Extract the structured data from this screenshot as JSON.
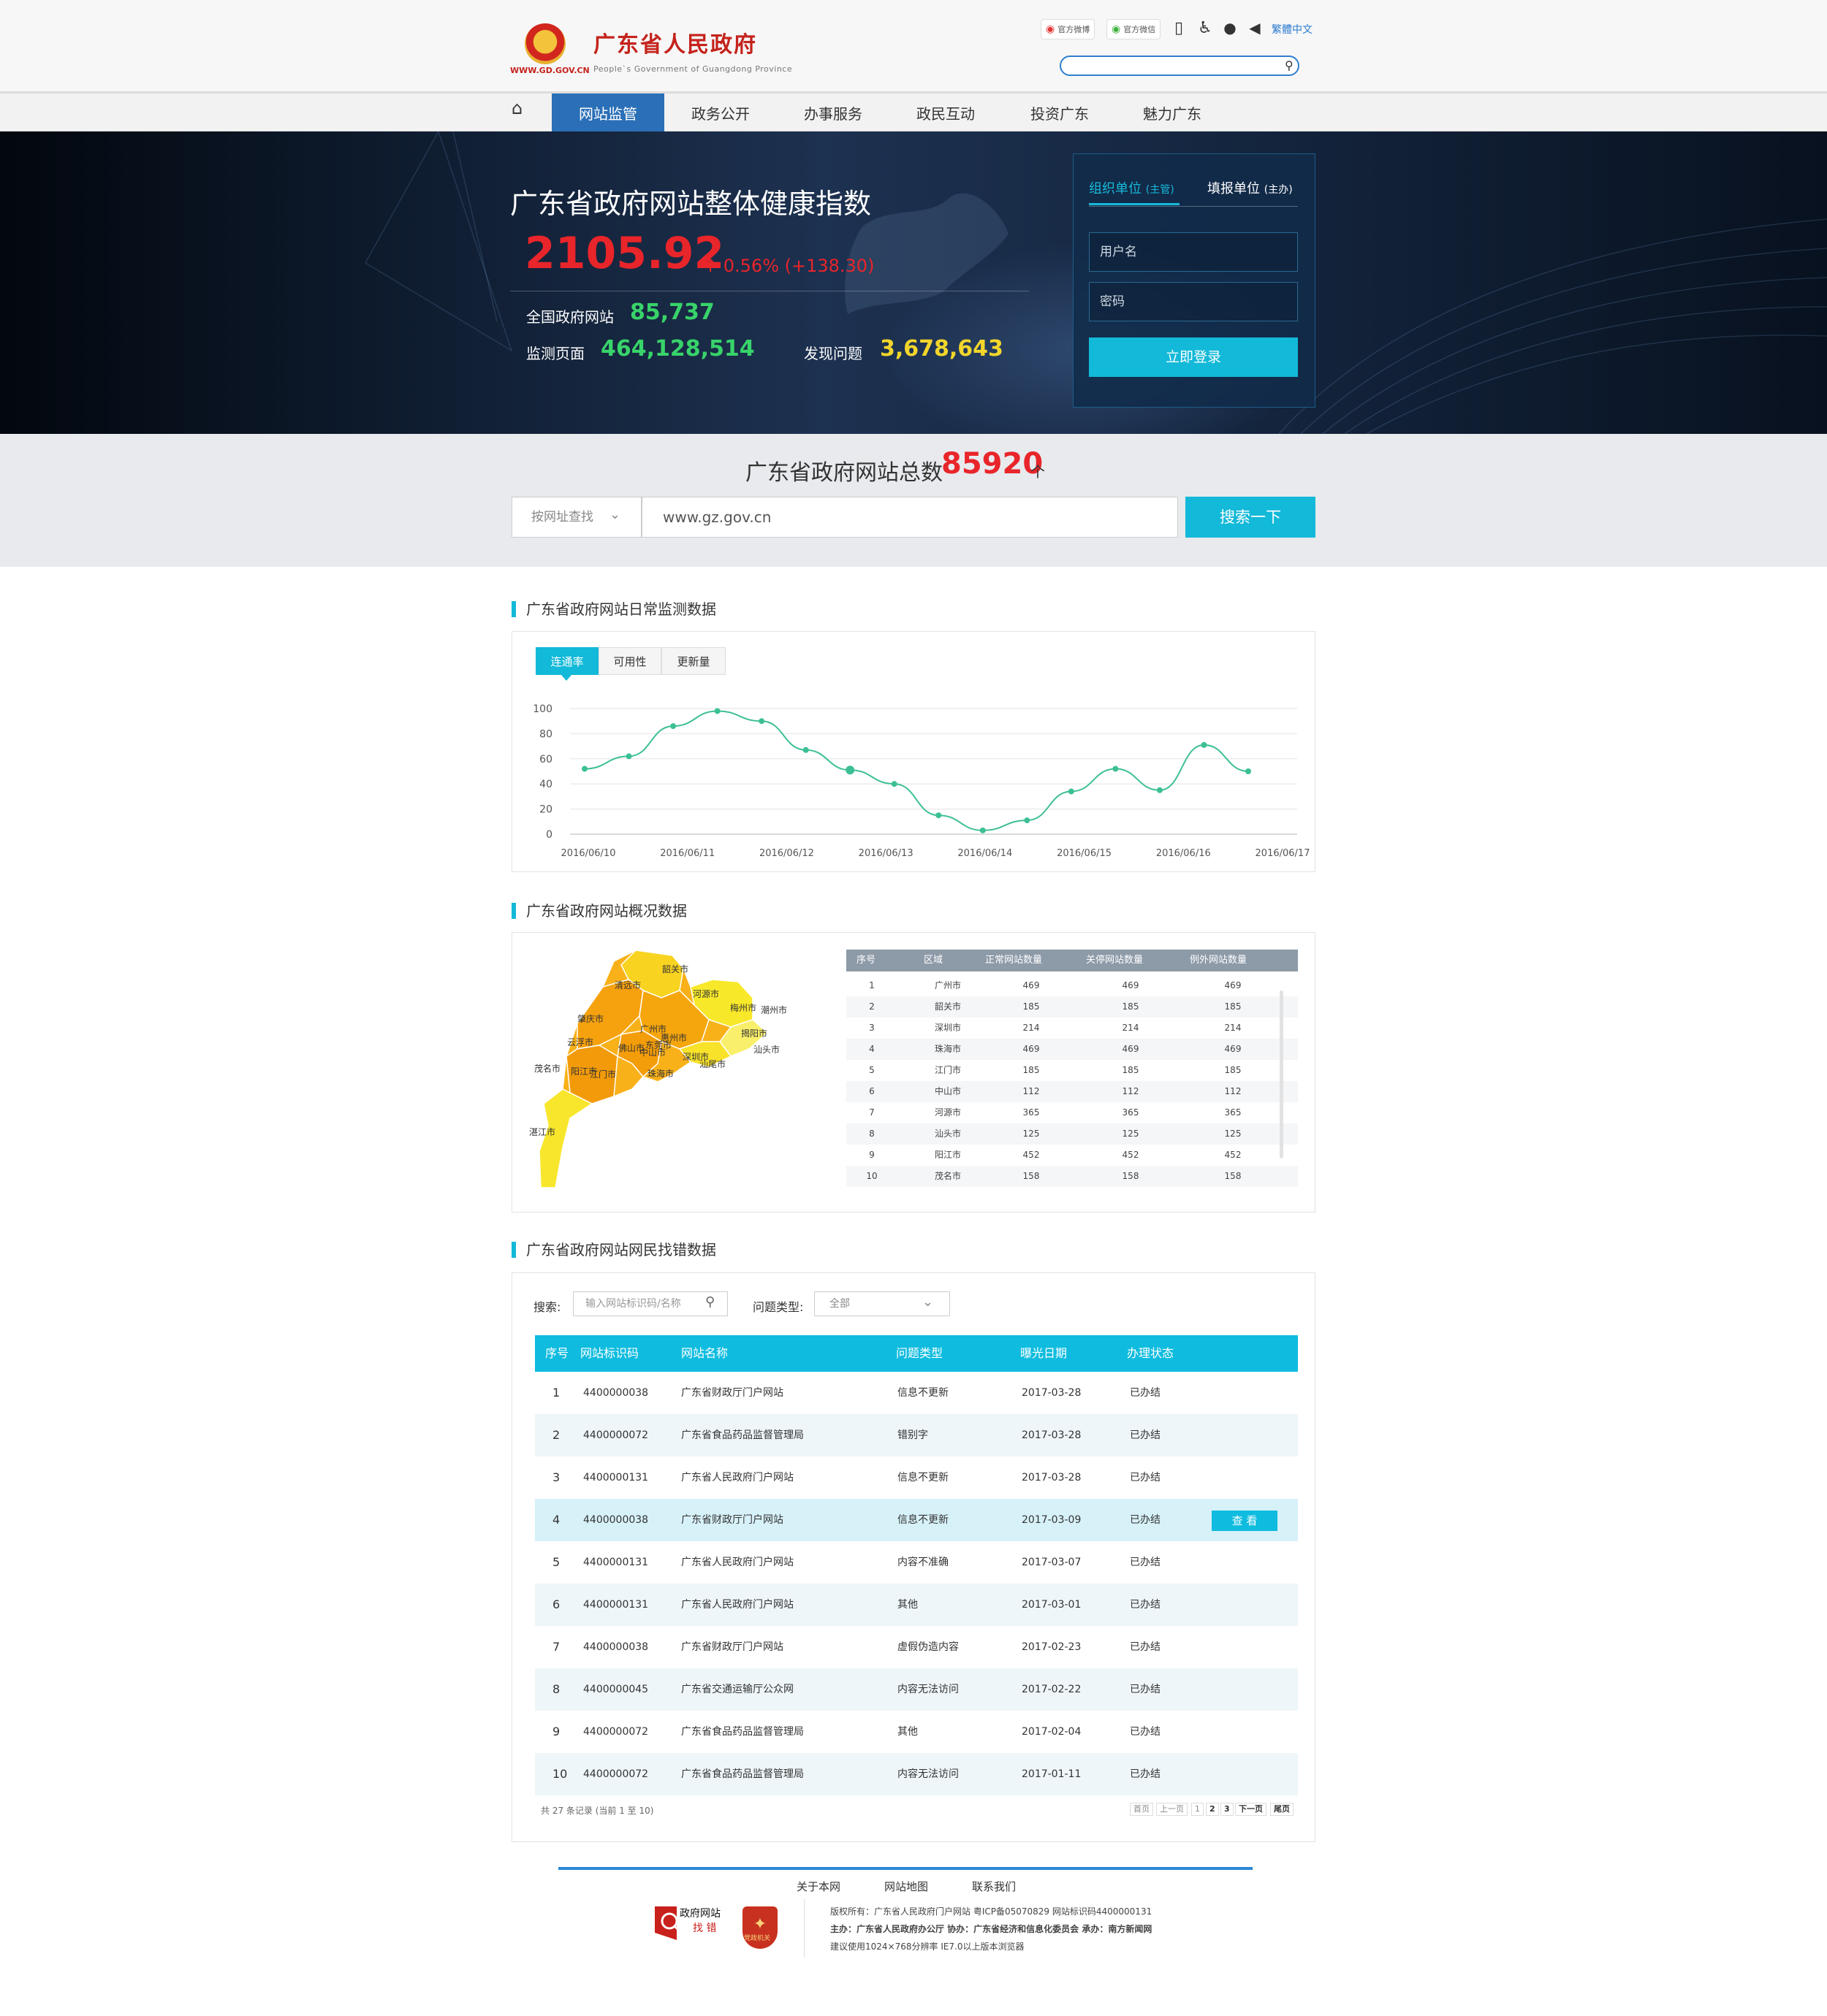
{
  "header": {
    "logo_url": "WWW.GD.GOV.CN",
    "title": "广东省人民政府",
    "subtitle": "People`s Government of Guangdong Province",
    "weibo": "官方微博",
    "wechat": "官方微信",
    "lang": "繁體中文"
  },
  "nav": [
    "网站监管",
    "政务公开",
    "办事服务",
    "政民互动",
    "投资广东",
    "魅力广东"
  ],
  "banner": {
    "title": "广东省政府网站整体健康指数",
    "index": "2105.92",
    "change": "0.56%  (+138.30)",
    "national_label": "全国政府网站",
    "national_value": "85,737",
    "pages_label": "监测页面",
    "pages_value": "464,128,514",
    "issues_label": "发现问题",
    "issues_value": "3,678,643"
  },
  "login": {
    "tab1": "组织单位",
    "tab1_sub": "(主管)",
    "tab2": "填报单位",
    "tab2_sub": "(主办)",
    "username": "用户名",
    "password": "密码",
    "button": "立即登录"
  },
  "search": {
    "total_label": "广东省政府网站总数",
    "total_value": "85920",
    "total_unit": "个",
    "select": "按网址查找",
    "input": "www.gz.gov.cn",
    "button": "搜索一下"
  },
  "sections": {
    "monitor": "广东省政府网站日常监测数据",
    "overview": "广东省政府网站概况数据",
    "bugs": "广东省政府网站网民找错数据"
  },
  "monitor_tabs": [
    "连通率",
    "可用性",
    "更新量"
  ],
  "chart_data": {
    "type": "line",
    "x": [
      "2016/06/10",
      "",
      "2016/06/11",
      "",
      "",
      "2016/06/12",
      "",
      "2016/06/13",
      "",
      "",
      "2016/06/14",
      "",
      "2016/06/15",
      "",
      "2016/06/16",
      "2016/06/17"
    ],
    "x_ticks": [
      "2016/06/10",
      "2016/06/11",
      "2016/06/12",
      "2016/06/13",
      "2016/06/14",
      "2016/06/15",
      "2016/06/16",
      "2016/06/17"
    ],
    "values": [
      52,
      62,
      86,
      98,
      90,
      67,
      51,
      40,
      15,
      3,
      11,
      34,
      52,
      35,
      71,
      50
    ],
    "ylim": [
      0,
      100
    ],
    "yticks": [
      0,
      20,
      40,
      60,
      80,
      100
    ],
    "grid": true,
    "color": "#3dbf96"
  },
  "map_labels": [
    "韶关市",
    "清远市",
    "河源市",
    "梅州市",
    "潮州市",
    "肇庆市",
    "广州市",
    "惠州市",
    "揭阳市",
    "汕头市",
    "云浮市",
    "佛山市",
    "东莞市",
    "汕尾市",
    "中山市",
    "深圳市",
    "江门市",
    "珠海市",
    "茂名市",
    "阳江市",
    "湛江市"
  ],
  "overview_table": {
    "headers": [
      "序号",
      "区域",
      "正常网站数量",
      "关停网站数量",
      "例外网站数量"
    ],
    "rows": [
      [
        "1",
        "广州市",
        "469",
        "469",
        "469"
      ],
      [
        "2",
        "韶关市",
        "185",
        "185",
        "185"
      ],
      [
        "3",
        "深圳市",
        "214",
        "214",
        "214"
      ],
      [
        "4",
        "珠海市",
        "469",
        "469",
        "469"
      ],
      [
        "5",
        "江门市",
        "185",
        "185",
        "185"
      ],
      [
        "6",
        "中山市",
        "112",
        "112",
        "112"
      ],
      [
        "7",
        "河源市",
        "365",
        "365",
        "365"
      ],
      [
        "8",
        "汕头市",
        "125",
        "125",
        "125"
      ],
      [
        "9",
        "阳江市",
        "452",
        "452",
        "452"
      ],
      [
        "10",
        "茂名市",
        "158",
        "158",
        "158"
      ]
    ]
  },
  "bug_filter": {
    "search_label": "搜索:",
    "search_placeholder": "输入网站标识码/名称",
    "type_label": "问题类型:",
    "type_value": "全部"
  },
  "bug_table": {
    "headers": [
      "序号",
      "网站标识码",
      "网站名称",
      "问题类型",
      "曝光日期",
      "办理状态"
    ],
    "rows": [
      [
        "1",
        "4400000038",
        "广东省财政厅门户网站",
        "信息不更新",
        "2017-03-28",
        "已办结"
      ],
      [
        "2",
        "4400000072",
        "广东省食品药品监督管理局",
        "错别字",
        "2017-03-28",
        "已办结"
      ],
      [
        "3",
        "4400000131",
        "广东省人民政府门户网站",
        "信息不更新",
        "2017-03-28",
        "已办结"
      ],
      [
        "4",
        "4400000038",
        "广东省财政厅门户网站",
        "信息不更新",
        "2017-03-09",
        "已办结"
      ],
      [
        "5",
        "4400000131",
        "广东省人民政府门户网站",
        "内容不准确",
        "2017-03-07",
        "已办结"
      ],
      [
        "6",
        "4400000131",
        "广东省人民政府门户网站",
        "其他",
        "2017-03-01",
        "已办结"
      ],
      [
        "7",
        "4400000038",
        "广东省财政厅门户网站",
        "虚假伪造内容",
        "2017-02-23",
        "已办结"
      ],
      [
        "8",
        "4400000045",
        "广东省交通运输厅公众网",
        "内容无法访问",
        "2017-02-22",
        "已办结"
      ],
      [
        "9",
        "4400000072",
        "广东省食品药品监督管理局",
        "其他",
        "2017-02-04",
        "已办结"
      ],
      [
        "10",
        "4400000072",
        "广东省食品药品监督管理局",
        "内容无法访问",
        "2017-01-11",
        "已办结"
      ]
    ],
    "view_button": "查 看"
  },
  "pagination": {
    "info": "共 27 条记录 (当前 1 至 10)",
    "first": "首页",
    "prev": "上一页",
    "p1": "1",
    "p2": "2",
    "p3": "3",
    "next": "下一页",
    "last": "尾页"
  },
  "footer": {
    "links": [
      "关于本网",
      "网站地图",
      "联系我们"
    ],
    "bug_logo_line1": "政府网站",
    "bug_logo_line2": "找 错",
    "party_label": "党政机关",
    "line1": "版权所有：广东省人民政府门户网站  粤ICP备05070829  网站标识码4400000131",
    "line2": "主办：广东省人民政府办公厅  协办：广东省经济和信息化委员会  承办：南方新闻网",
    "line3": "建议使用1024×768分辨率  IE7.0以上版本浏览器"
  },
  "colors": {
    "accent": "#13b9d8",
    "brand_red": "#c4231c",
    "nav_active": "#2a6fb7",
    "green": "#38d36a",
    "yellow": "#f2d62b"
  }
}
